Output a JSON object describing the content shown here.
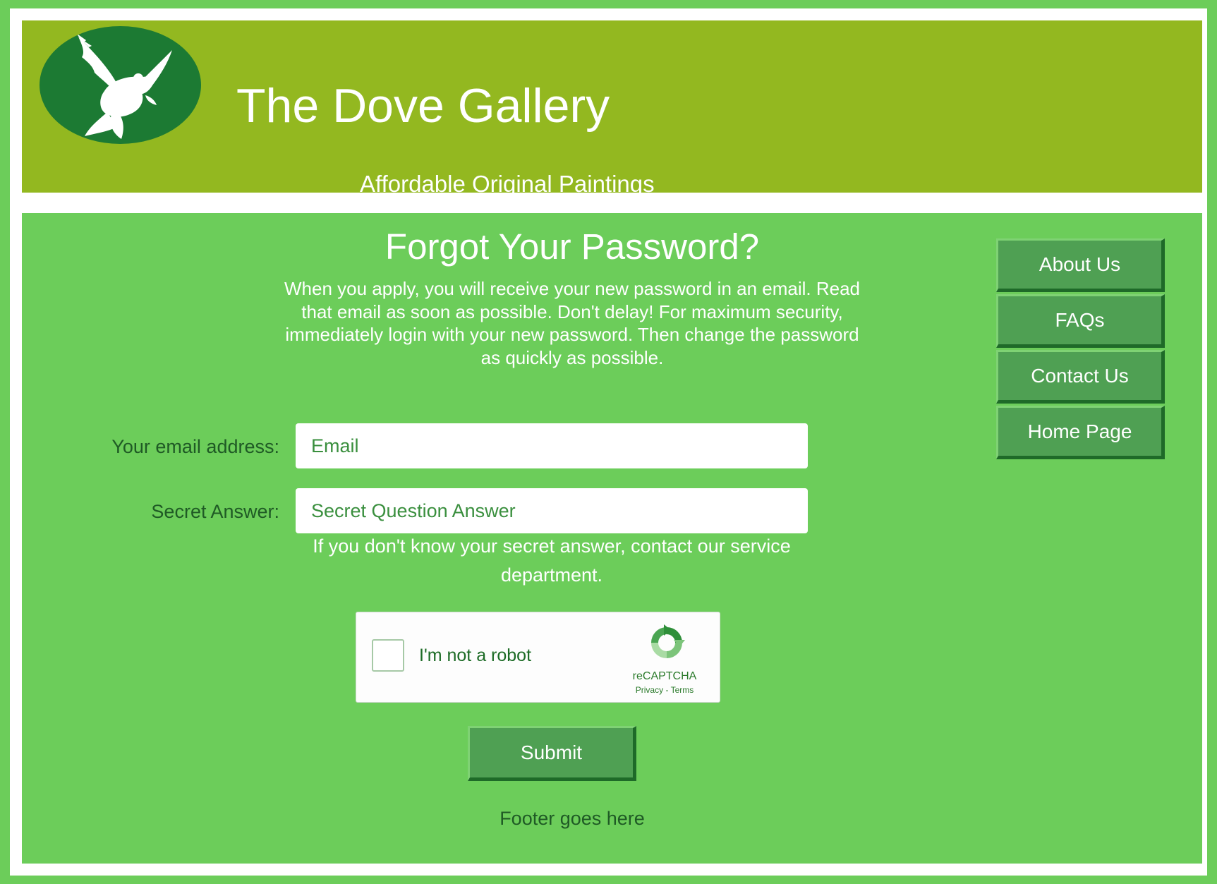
{
  "header": {
    "site_title": "The Dove Gallery",
    "tagline": "Affordable Original Paintings",
    "logo_icon": "dove-icon"
  },
  "main": {
    "page_title": "Forgot Your Password?",
    "intro": "When you apply, you will receive your new password in an email. Read that email as soon as possible. Don't delay! For maximum security, immediately login with your new password. Then change the password as quickly as possible.",
    "email": {
      "label": "Your email address:",
      "placeholder": "Email",
      "value": ""
    },
    "secret": {
      "label": "Secret Answer:",
      "placeholder": "Secret Question Answer",
      "value": ""
    },
    "help_text": "If you don't know your secret answer, contact our service department.",
    "captcha": {
      "label": "I'm not a robot",
      "brand": "reCAPTCHA",
      "privacy": "Privacy",
      "separator": " - ",
      "terms": "Terms",
      "checked": false
    },
    "submit_label": "Submit",
    "footer": "Footer goes here"
  },
  "nav": {
    "items": [
      {
        "label": "About Us"
      },
      {
        "label": "FAQs"
      },
      {
        "label": "Contact Us"
      },
      {
        "label": "Home Page"
      }
    ]
  },
  "colors": {
    "background": "#6ccd5a",
    "header": "#93b820",
    "logo": "#1c7a33",
    "button": "#4fa053",
    "label_text": "#1f5a25"
  }
}
